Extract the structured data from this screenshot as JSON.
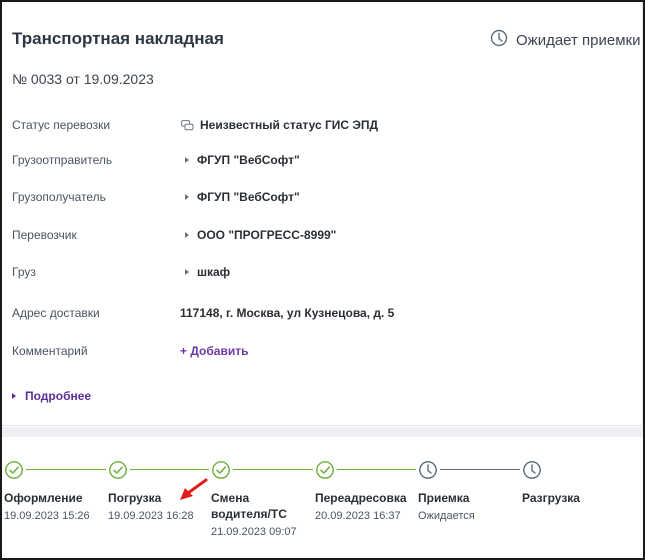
{
  "header": {
    "title": "Транспортная накладная",
    "status_text": "Ожидает приемки",
    "status_icon": "clock-icon",
    "subtitle": "№ 0033 от 19.09.2023"
  },
  "fields": [
    {
      "label": "Статус перевозки",
      "value": "Неизвестный статус ГИС ЭПД"
    },
    {
      "label": "Грузоотправитель",
      "value": "ФГУП \"ВебСофт\""
    },
    {
      "label": "Грузополучатель",
      "value": "ФГУП \"ВебСофт\""
    },
    {
      "label": "Перевозчик",
      "value": "ООО \"ПРОГРЕСС-8999\""
    },
    {
      "label": "Груз",
      "value": "шкаф"
    },
    {
      "label": "Адрес доставки",
      "value": "117148, г. Москва, ул Кузнецова, д. 5"
    },
    {
      "label": "Комментарий",
      "value": "+ Добавить"
    }
  ],
  "more_label": "Подробнее",
  "timeline": {
    "done_color": "#6cae3a",
    "pending_color": "#5f6b7a",
    "steps": [
      {
        "name": "Оформление",
        "date": "19.09.2023 15:26",
        "state": "done"
      },
      {
        "name": "Погрузка",
        "date": "19.09.2023 16:28",
        "state": "done"
      },
      {
        "name": "Смена водителя/ТС",
        "date": "21.09.2023 09:07",
        "state": "done"
      },
      {
        "name": "Переадресовка",
        "date": "20.09.2023 16:37",
        "state": "done"
      },
      {
        "name": "Приемка",
        "date": "Ожидается",
        "state": "pending"
      },
      {
        "name": "Разгрузка",
        "date": "",
        "state": "pending"
      }
    ]
  }
}
